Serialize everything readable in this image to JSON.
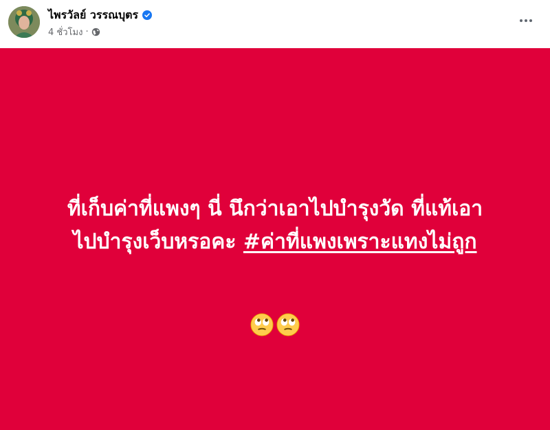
{
  "post": {
    "author": "ไพรวัลย์ วรรณบุตร",
    "time": "4 ชั่วโมง",
    "separator": "·",
    "verified_icon": "verified-badge-icon",
    "privacy_icon": "globe-icon",
    "more_icon": "more-options-icon"
  },
  "content": {
    "background_color": "#e0003a",
    "text_color": "#ffffff",
    "line1": "ที่เก็บค่าที่แพงๆ นี่ นึกว่าเอาไปบำรุงวัด ที่แท้เอา",
    "line2_prefix": "ไปบำรุงเว็บหรอคะ ",
    "hashtag": "#ค่าที่แพงเพราะแทงไม่ถูก",
    "emojis": [
      "face-with-rolling-eyes",
      "face-with-rolling-eyes"
    ]
  },
  "colors": {
    "verified_blue": "#1877f2",
    "secondary_text": "#65676b"
  }
}
